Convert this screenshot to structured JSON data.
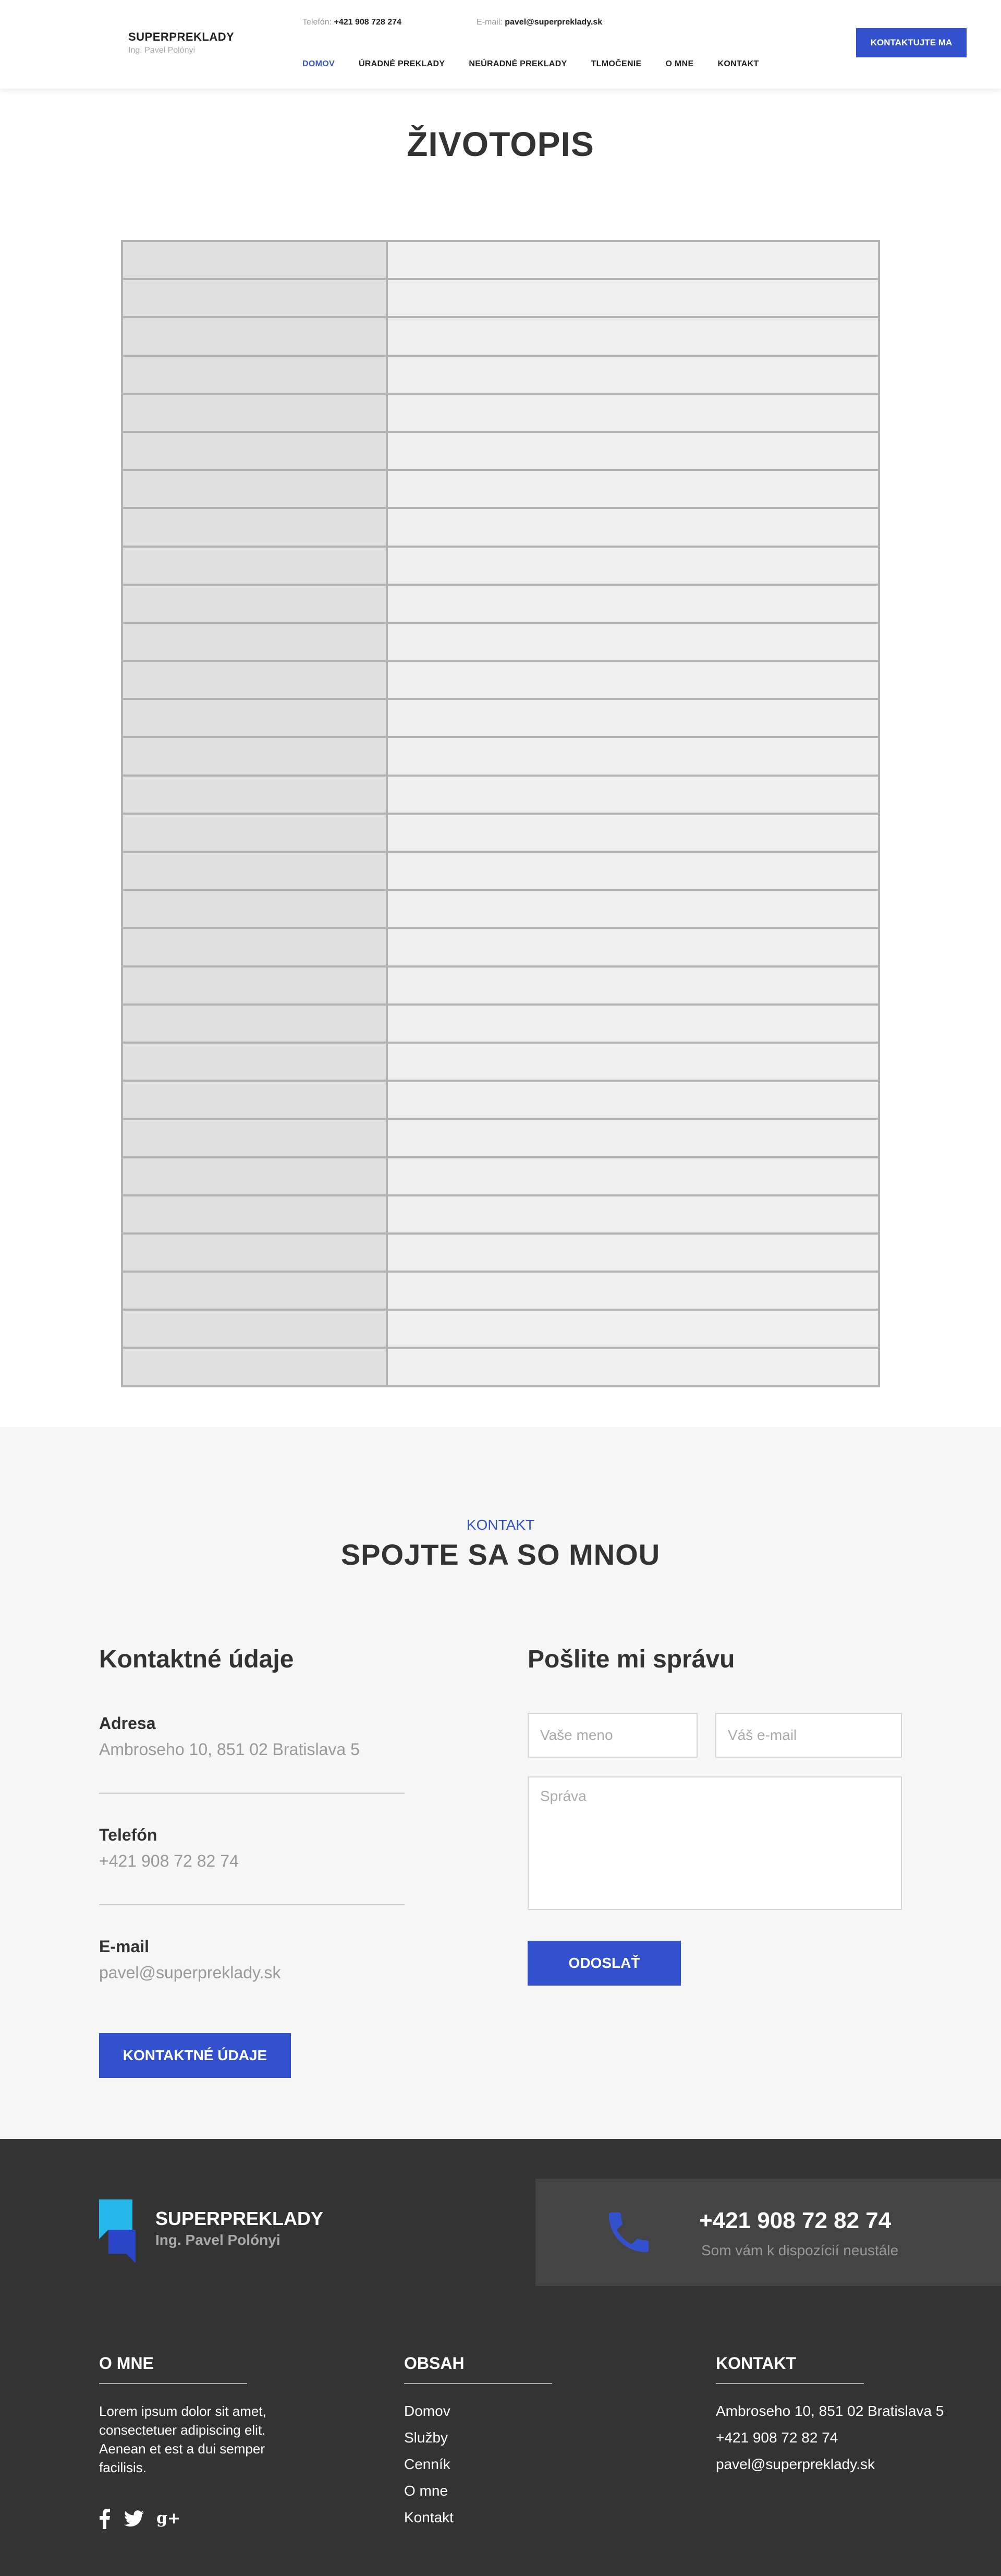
{
  "header": {
    "brand": "SUPERPREKLADY",
    "brand_sub": "Ing. Pavel Polónyi",
    "phone_label": "Telefón:",
    "phone_value": "+421 908 728 274",
    "email_label": "E-mail:",
    "email_value": "pavel@superpreklady.sk",
    "nav": [
      "DOMOV",
      "ÚRADNÉ PREKLADY",
      "NEÚRADNÉ PREKLADY",
      "TLMOČENIE",
      "O MNE",
      "KONTAKT"
    ],
    "active_nav": "DOMOV",
    "cta": "KONTAKTUJTE MA"
  },
  "page_title": "ŽIVOTOPIS",
  "cv_table": {
    "rows": 30,
    "columns": 2
  },
  "contact": {
    "kicker": "KONTAKT",
    "title": "SPOJTE SA SO MNOU",
    "details_title": "Kontaktné údaje",
    "address_label": "Adresa",
    "address_value": "Ambroseho 10, 851 02 Bratislava 5",
    "phone_label": "Telefón",
    "phone_value": "+421 908 72 82 74",
    "email_label": "E-mail",
    "email_value": "pavel@superpreklady.sk",
    "details_button": "KONTAKTNÉ ÚDAJE",
    "form_title": "Pošlite mi správu",
    "name_placeholder": "Vaše meno",
    "email_placeholder": "Váš e-mail",
    "message_placeholder": "Správa",
    "send_button": "ODOSLAŤ"
  },
  "footer": {
    "brand": "SUPERPREKLADY",
    "brand_sub": "Ing. Pavel Polónyi",
    "phone": "+421 908 72 82 74",
    "phone_sub": "Som vám k dispozícií neustále",
    "about_title": "O MNE",
    "about_text": "Lorem ipsum dolor sit amet, consectetuer adipiscing elit. Aenean et est a dui semper facilisis.",
    "content_title": "OBSAH",
    "content_links": [
      "Domov",
      "Služby",
      "Cenník",
      "O mne",
      "Kontakt"
    ],
    "contact_title": "KONTAKT",
    "contact_lines": [
      "Ambroseho 10, 851 02 Bratislava 5",
      "+421 908 72 82 74",
      "pavel@superpreklady.sk"
    ],
    "social": [
      "facebook-icon",
      "twitter-icon",
      "google-plus-icon"
    ]
  },
  "colors": {
    "accent": "#3451cd",
    "logo_light": "#25b7ea",
    "logo_dark": "#2b45c9",
    "footer_bg": "#333333",
    "section_bg": "#f6f6f6"
  }
}
